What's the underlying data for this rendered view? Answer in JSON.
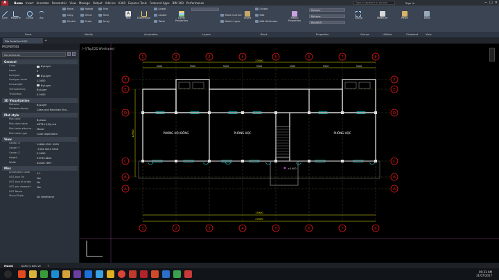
{
  "app": {
    "logo_letter": "A",
    "menu": [
      "Home",
      "Insert",
      "Annotate",
      "Parametric",
      "View",
      "Manage",
      "Output",
      "Add-ins",
      "A360",
      "Express Tools",
      "Featured Apps",
      "BIM 360",
      "Performance"
    ],
    "search_placeholder": "Type a keyword or phrase",
    "sign_in": "Sign In",
    "window_controls": [
      "−",
      "□",
      "✕"
    ]
  },
  "ribbon": {
    "draw": [
      "Line",
      "Polyline",
      "Circle",
      "Arc"
    ],
    "modify_small": [
      [
        "Move",
        "Rotate",
        "Trim"
      ],
      [
        "Copy",
        "Mirror",
        "Fillet"
      ],
      [
        "Stretch",
        "Scale",
        "Array"
      ]
    ],
    "annotation": [
      "Text",
      "Dimension"
    ],
    "annotation_small": [
      "Linear",
      "Leader",
      "Table"
    ],
    "layers_label": "Layer Properties",
    "layer_small": [
      "Make Current",
      "Match Layer"
    ],
    "block": [
      "Insert"
    ],
    "block_small": [
      "Create",
      "Edit",
      "Edit Attributes"
    ],
    "match_label": "Match Properties",
    "bylayer": [
      "ByLayer",
      "ByLayer",
      "BYLAYER"
    ],
    "group_label": "Group",
    "measure_label": "Measure",
    "paste_label": "Paste",
    "base_label": "Base",
    "panel_titles": [
      "Draw",
      "Modify",
      "Annotation",
      "Layers",
      "Block",
      "Properties",
      "Groups",
      "Utilities",
      "Clipboard",
      "View"
    ]
  },
  "filetab": {
    "name": "File AutoCad HQ*",
    "plus": "+"
  },
  "properties": {
    "title": "PROPERTIES",
    "selection": "No selection",
    "sections": [
      {
        "name": "General",
        "rows": [
          [
            "Color",
            "ByLayer"
          ],
          [
            "Layer",
            "0"
          ],
          [
            "Linetype",
            "ByLayer"
          ],
          [
            "Linetype scale",
            "1.0000"
          ],
          [
            "Lineweight",
            "ByLayer"
          ],
          [
            "Transparency",
            "ByLayer"
          ],
          [
            "Thickness",
            "0.0000"
          ]
        ]
      },
      {
        "name": "3D Visualization",
        "rows": [
          [
            "Material",
            "ByLayer"
          ],
          [
            "Shadow display",
            "Casts and Receives Sha..."
          ]
        ]
      },
      {
        "name": "Plot style",
        "rows": [
          [
            "Plot style",
            "ByColor"
          ],
          [
            "Plot style table",
            "NET39 (HQ).ctb"
          ],
          [
            "Plot table attache...",
            "Model"
          ],
          [
            "Plot table type",
            "Color dependent"
          ]
        ]
      },
      {
        "name": "View",
        "rows": [
          [
            "Center X",
            "14698.0291 0993"
          ],
          [
            "Center Y",
            "-7490.0094 3246"
          ],
          [
            "Center Z",
            "0.0000"
          ],
          [
            "Height",
            "23739.8812"
          ],
          [
            "Width",
            "44426.7897"
          ]
        ]
      },
      {
        "name": "Misc",
        "rows": [
          [
            "Annotation scale",
            "1:1"
          ],
          [
            "UCS icon On",
            "Yes"
          ],
          [
            "UCS icon at origin",
            "No"
          ],
          [
            "UCS per viewport",
            "Yes"
          ],
          [
            "UCS Name",
            ""
          ],
          [
            "Visual Style",
            "2D Wireframe"
          ]
        ]
      }
    ]
  },
  "viewport": {
    "label": "[−][Top][2D Wireframe]",
    "grid_columns": [
      "1",
      "2",
      "3",
      "4",
      "5",
      "6",
      "7",
      "8"
    ],
    "grid_rows": [
      "F",
      "E",
      "D",
      "C",
      "B",
      "A"
    ],
    "room_labels": [
      "PHÒNG HỘI ĐỒNG",
      "PHÒNG HỌC",
      "PHÒNG HỌC"
    ],
    "overall_dim": "27000",
    "bay_dims": [
      "3900",
      "3900",
      "3900",
      "3900",
      "3900",
      "3900",
      "3900"
    ],
    "bottom_dims": [
      "15900",
      "27000"
    ],
    "side_dims": [
      "12900",
      "2500"
    ],
    "level_mark": "±0.000"
  },
  "layout_tabs": [
    "Model",
    "Quản lý bản vẽ",
    "+"
  ],
  "clock": {
    "time": "09:31 AM",
    "date": "31/07/2017"
  },
  "colors": {
    "ribbon": "#3b4452",
    "palette": "#2b313a",
    "grid_red": "#e01818",
    "dim_yellow": "#e6e600",
    "wall_white": "#f0f0f0",
    "door_cyan": "#22dddd"
  }
}
